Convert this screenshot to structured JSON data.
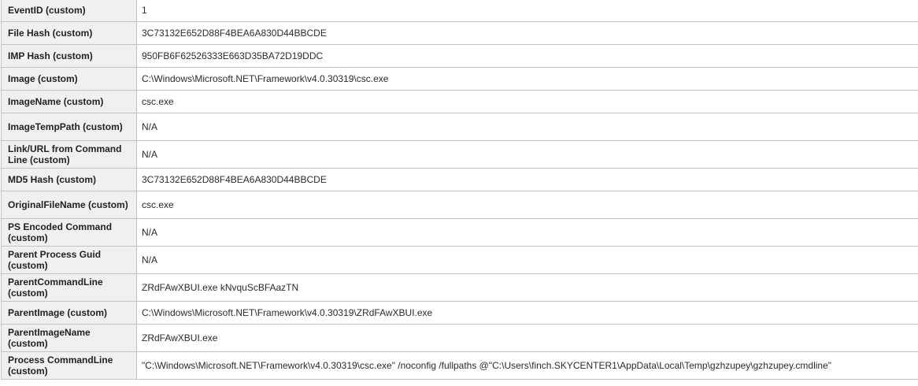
{
  "rows": [
    {
      "key": "EventID (custom)",
      "value": "1"
    },
    {
      "key": "File Hash (custom)",
      "value": "3C73132E652D88F4BEA6A830D44BBCDE"
    },
    {
      "key": "IMP Hash (custom)",
      "value": "950FB6F62526333E663D35BA72D19DDC"
    },
    {
      "key": "Image (custom)",
      "value": "C:\\Windows\\Microsoft.NET\\Framework\\v4.0.30319\\csc.exe"
    },
    {
      "key": "ImageName (custom)",
      "value": "csc.exe"
    },
    {
      "key": "ImageTempPath (custom)",
      "value": "N/A"
    },
    {
      "key": "Link/URL from Command Line (custom)",
      "value": "N/A"
    },
    {
      "key": "MD5 Hash (custom)",
      "value": "3C73132E652D88F4BEA6A830D44BBCDE"
    },
    {
      "key": "OriginalFileName (custom)",
      "value": "csc.exe"
    },
    {
      "key": "PS Encoded Command (custom)",
      "value": "N/A"
    },
    {
      "key": "Parent Process Guid (custom)",
      "value": "N/A"
    },
    {
      "key": "ParentCommandLine (custom)",
      "value": "ZRdFAwXBUI.exe  kNvquScBFAazTN"
    },
    {
      "key": "ParentImage (custom)",
      "value": "C:\\Windows\\Microsoft.NET\\Framework\\v4.0.30319\\ZRdFAwXBUI.exe"
    },
    {
      "key": "ParentImageName (custom)",
      "value": "ZRdFAwXBUI.exe"
    },
    {
      "key": "Process CommandLine (custom)",
      "value": "\"C:\\Windows\\Microsoft.NET\\Framework\\v4.0.30319\\csc.exe\" /noconfig /fullpaths @\"C:\\Users\\finch.SKYCENTER1\\AppData\\Local\\Temp\\gzhzupey\\gzhzupey.cmdline\""
    }
  ]
}
